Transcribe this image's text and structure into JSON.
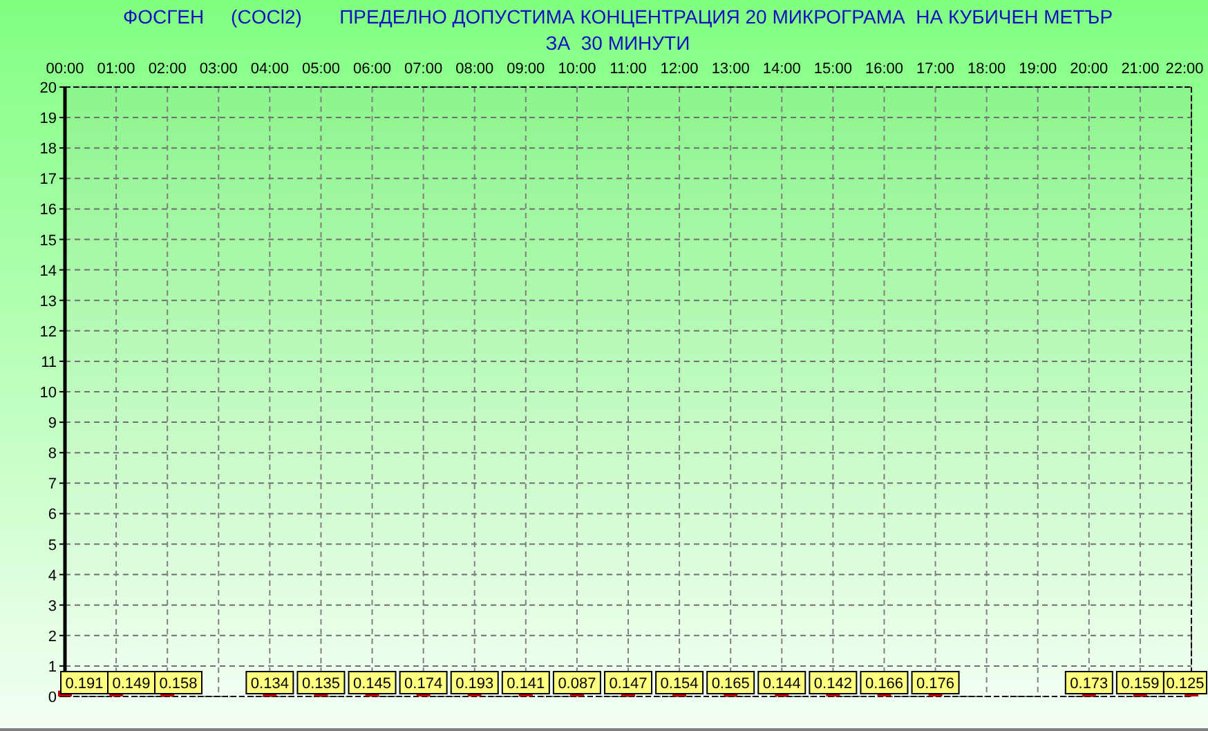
{
  "chart_data": {
    "type": "bar",
    "title": [
      "ФОСГЕН     (COCl2)       ПРЕДЕЛНО ДОПУСТИМА КОНЦЕНТРАЦИЯ 20 МИКРОГРАМА  НА КУБИЧЕН МЕТЪР",
      "ЗА  30 МИНУТИ"
    ],
    "categories": [
      "00:00",
      "01:00",
      "02:00",
      "03:00",
      "04:00",
      "05:00",
      "06:00",
      "07:00",
      "08:00",
      "09:00",
      "10:00",
      "11:00",
      "12:00",
      "13:00",
      "14:00",
      "15:00",
      "16:00",
      "17:00",
      "18:00",
      "19:00",
      "20:00",
      "21:00",
      "22:00"
    ],
    "series": [
      {
        "color": "#c00000",
        "values": [
          0.191,
          0.149,
          0.158,
          null,
          0.134,
          0.135,
          0.145,
          0.174,
          0.193,
          0.141,
          0.087,
          0.147,
          0.154,
          0.165,
          0.144,
          0.142,
          0.166,
          0.176,
          null,
          null,
          0.173,
          0.159,
          0.125
        ]
      }
    ],
    "ylim": [
      0,
      20
    ],
    "yticks": [
      0,
      1,
      2,
      3,
      4,
      5,
      6,
      7,
      8,
      9,
      10,
      11,
      12,
      13,
      14,
      15,
      16,
      17,
      18,
      19,
      20
    ],
    "data_labels": true,
    "grid": true
  }
}
